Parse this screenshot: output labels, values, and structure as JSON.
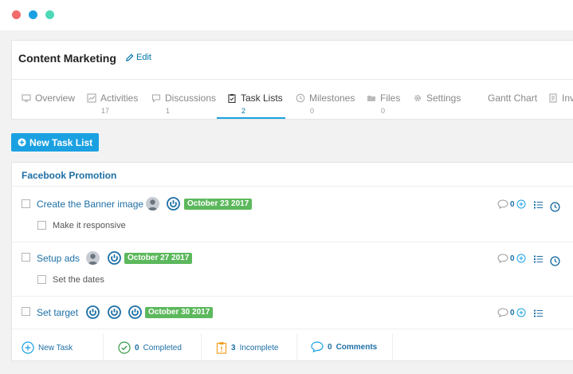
{
  "window": {
    "dots": [
      "#f26b6b",
      "#1ba1e2",
      "#4ed8b6"
    ]
  },
  "project": {
    "title": "Content Marketing",
    "edit_label": "Edit"
  },
  "tabs": [
    {
      "label": "Overview",
      "count": "",
      "icon": "monitor-icon"
    },
    {
      "label": "Activities",
      "count": "17",
      "icon": "chart-icon"
    },
    {
      "label": "Discussions",
      "count": "1",
      "icon": "chat-icon"
    },
    {
      "label": "Task Lists",
      "count": "2",
      "icon": "clipboard-icon"
    },
    {
      "label": "Milestones",
      "count": "0",
      "icon": "clock-icon"
    },
    {
      "label": "Files",
      "count": "0",
      "icon": "folder-icon"
    },
    {
      "label": "Settings",
      "count": "",
      "icon": "gear-icon"
    },
    {
      "label": "Gantt Chart",
      "count": "",
      "icon": ""
    },
    {
      "label": "Inv",
      "count": "",
      "icon": "invoice-icon"
    }
  ],
  "new_task_list_label": "New Task List",
  "task_list": {
    "title": "Facebook Promotion",
    "tasks": [
      {
        "name": "Create the Banner image",
        "date": "October 23 2017",
        "comments": "0",
        "subtask": "Make it responsive"
      },
      {
        "name": "Setup ads",
        "date": "October 27 2017",
        "comments": "0",
        "subtask": "Set the dates"
      },
      {
        "name": "Set target",
        "date": "October 30 2017",
        "comments": "0",
        "subtask": ""
      }
    ],
    "footer": {
      "new_task": "New Task",
      "completed_count": "0",
      "completed_label": "Completed",
      "incomplete_count": "3",
      "incomplete_label": "Incomplete",
      "comments_count": "0",
      "comments_label": "Comments"
    }
  },
  "colors": {
    "accent": "#1ba1e2",
    "link": "#1d6fa5",
    "badge_green": "#5cb85c"
  }
}
